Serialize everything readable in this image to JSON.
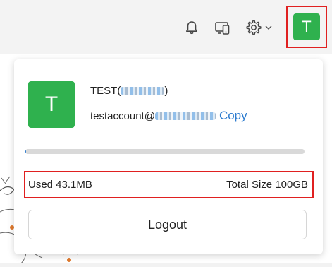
{
  "header": {
    "avatar_letter": "T",
    "icons": [
      "bell-icon",
      "devices-icon",
      "gear-icon",
      "chevron-down-icon"
    ]
  },
  "account_popup": {
    "avatar_letter": "T",
    "name_prefix": "TEST(",
    "name_suffix": ")",
    "email_prefix": "testaccount@",
    "copy_label": "Copy",
    "storage": {
      "used_label": "Used 43.1MB",
      "total_label": "Total Size 100GB",
      "used_fraction": 0.000431
    },
    "logout_label": "Logout"
  },
  "colors": {
    "avatar": "#2fb14e",
    "link": "#2e7ccf",
    "highlight_border": "#e02020",
    "progress_track": "#d9d9d9"
  }
}
